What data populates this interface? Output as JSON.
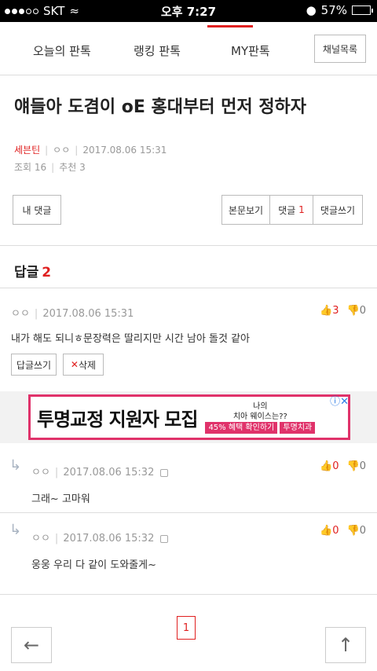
{
  "status": {
    "carrier": "SKT",
    "time": "오후 7:27",
    "battery": "57%",
    "battery_level": 0.57
  },
  "nav": {
    "tabs": [
      "오늘의 판톡",
      "랭킹 판톡",
      "MY판톡"
    ],
    "active_tab": "MY판톡",
    "channel_button": "채널목록"
  },
  "post": {
    "title": "얘들아 도겸이 oE 홍대부터 먼저 정하자",
    "author": "세븐틴",
    "nick": "ㅇㅇ",
    "date": "2017.08.06 15:31",
    "views": "조회 16",
    "recommend": "추천 3"
  },
  "actions": {
    "my_reply": "내 댓글",
    "view_post": "본문보기",
    "comment_label": "댓글",
    "comment_count": "1",
    "write_comment": "댓글쓰기"
  },
  "replies": {
    "label": "답글",
    "count": "2"
  },
  "comments": [
    {
      "nick": "ㅇㅇ",
      "date": "2017.08.06 15:31",
      "text": "내가 해도 되니ㅎ문장력은 딸리지만 시간 남아 돌것 같아",
      "up": "3",
      "down": "0",
      "reply_btn": "답글쓰기",
      "delete_btn": "삭제"
    },
    {
      "nick": "ㅇㅇ",
      "date": "2017.08.06 15:32",
      "text": "그래~ 고마워",
      "up": "0",
      "down": "0"
    },
    {
      "nick": "ㅇㅇ",
      "date": "2017.08.06 15:32",
      "text": "웅웅 우리 다 같이 도와줄게~",
      "up": "0",
      "down": "0"
    }
  ],
  "ad": {
    "headline": "투명교정 지원자 모집",
    "line1": "나의",
    "line2": "치아 웨이스는??",
    "badge": "45% 혜택 확인하기",
    "brand": "투명치과"
  },
  "pager": {
    "current": "1"
  },
  "icons": {
    "back": "back-arrow-icon",
    "top": "scroll-top-icon"
  }
}
